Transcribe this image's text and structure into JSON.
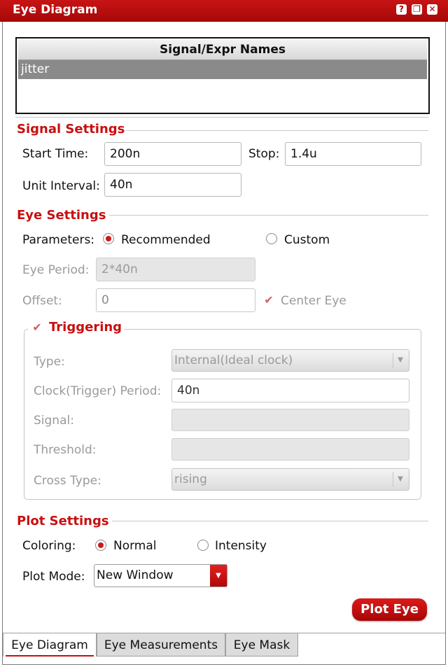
{
  "window": {
    "title": "Eye Diagram",
    "buttons": {
      "help": "?",
      "restore": "❐",
      "close": "✕"
    }
  },
  "signal_list": {
    "header": "Signal/Expr Names",
    "items": [
      "jitter"
    ]
  },
  "signal_settings": {
    "title": "Signal Settings",
    "start_time_label": "Start Time:",
    "start_time_value": "200n",
    "stop_label": "Stop:",
    "stop_value": "1.4u",
    "unit_interval_label": "Unit Interval:",
    "unit_interval_value": "40n"
  },
  "eye_settings": {
    "title": "Eye Settings",
    "parameters_label": "Parameters:",
    "recommended_label": "Recommended",
    "custom_label": "Custom",
    "selected": "Recommended",
    "eye_period_label": "Eye Period:",
    "eye_period_value": "2*40n",
    "offset_label": "Offset:",
    "offset_value": "0",
    "center_eye_label": "Center Eye",
    "center_eye_checked": true
  },
  "triggering": {
    "title": "Triggering",
    "checked": true,
    "type_label": "Type:",
    "type_value": "Internal(Ideal clock)",
    "clock_period_label": "Clock(Trigger) Period:",
    "clock_period_value": "40n",
    "signal_label": "Signal:",
    "signal_value": "",
    "threshold_label": "Threshold:",
    "threshold_value": "",
    "cross_type_label": "Cross Type:",
    "cross_type_value": "rising"
  },
  "plot_settings": {
    "title": "Plot Settings",
    "coloring_label": "Coloring:",
    "normal_label": "Normal",
    "intensity_label": "Intensity",
    "selected": "Normal",
    "plot_mode_label": "Plot Mode:",
    "plot_mode_value": "New Window",
    "plot_button": "Plot Eye"
  },
  "tabs": [
    {
      "label": "Eye Diagram",
      "active": true
    },
    {
      "label": "Eye Measurements",
      "active": false
    },
    {
      "label": "Eye Mask",
      "active": false
    }
  ],
  "colors": {
    "accent": "#c81010",
    "title_bar": "#b80c0c",
    "selection": "#8a8a8a"
  }
}
